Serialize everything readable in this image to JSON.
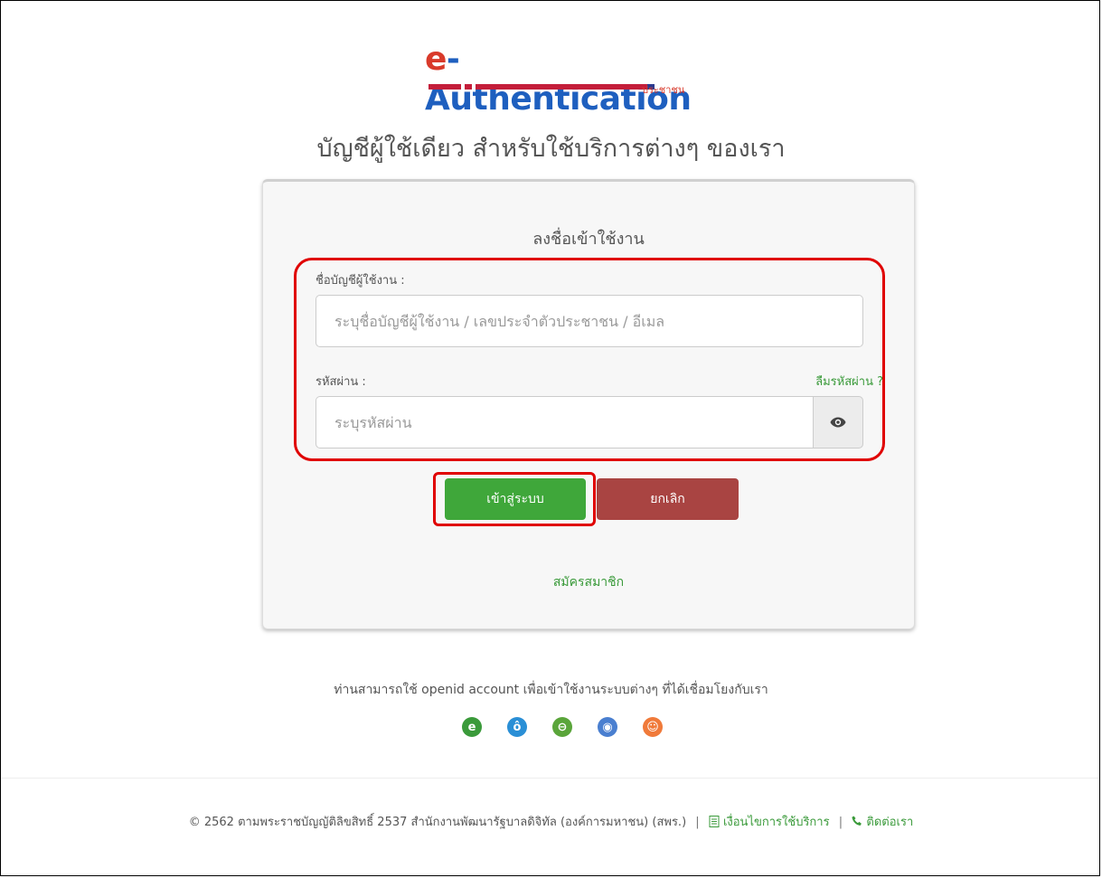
{
  "logo": {
    "e": "e",
    "rest": "-Authentication",
    "sub": "ประชาชน"
  },
  "tagline": "บัญชีผู้ใช้เดียว สำหรับใช้บริการต่างๆ ของเรา",
  "form": {
    "title": "ลงชื่อเข้าใช้งาน",
    "username_label": "ชื่อบัญชีผู้ใช้งาน :",
    "username_placeholder": "ระบุชื่อบัญชีผู้ใช้งาน / เลขประจำตัวประชาชน / อีเมล",
    "username_value": "",
    "password_label": "รหัสผ่าน :",
    "forgot_password": "ลืมรหัสผ่าน ?",
    "password_placeholder": "ระบุรหัสผ่าน",
    "password_value": "",
    "login_button": "เข้าสู่ระบบ",
    "cancel_button": "ยกเลิก",
    "register_link": "สมัครสมาชิก"
  },
  "openid": {
    "text": "ท่านสามารถใช้ openid account เพื่อเข้าใช้งานระบบต่างๆ ที่ได้เชื่อมโยงกับเรา",
    "providers": [
      {
        "icon": "e-icon",
        "glyph": "e",
        "color": "#3a9a3a"
      },
      {
        "icon": "water-drop-icon",
        "glyph": "ô",
        "color": "#2a8fd6"
      },
      {
        "icon": "circle-symbol-icon",
        "glyph": "⊖",
        "color": "#5aa53a"
      },
      {
        "icon": "globe-icon",
        "glyph": "◉",
        "color": "#4a7fd0"
      },
      {
        "icon": "seal-icon",
        "glyph": "☺",
        "color": "#f07a3a"
      }
    ]
  },
  "footer": {
    "copyright": "© 2562 ตามพระราชบัญญัติลิขสิทธิ์ 2537 สำนักงานพัฒนารัฐบาลดิจิทัล (องค์การมหาชน) (สพร.)",
    "terms_link": "เงื่อนไขการใช้บริการ",
    "contact_link": "ติดต่อเรา"
  },
  "colors": {
    "accent_green": "#3fa73a",
    "cancel_red": "#a94442",
    "highlight_red": "#e00000",
    "link_green": "#3a9a3a"
  }
}
